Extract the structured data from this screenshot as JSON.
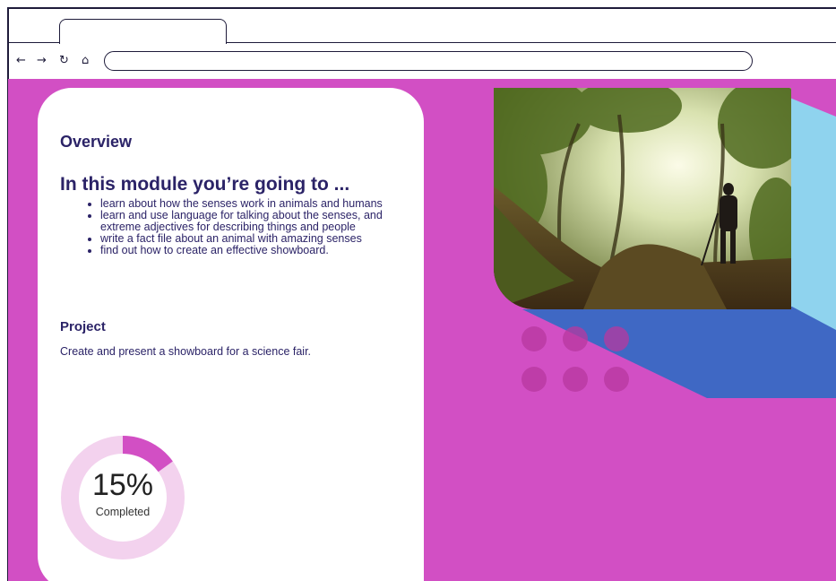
{
  "browser": {
    "nav_icons": {
      "back": "←",
      "forward": "→",
      "reload": "↻",
      "home": "⌂"
    },
    "url": ""
  },
  "card": {
    "overview_title": "Overview",
    "module_heading": "In this module you’re going to ...",
    "bullets": [
      "learn about how the senses work in animals and humans",
      "learn and use language for talking about the senses, and extreme adjectives for describing things and people",
      "write a fact file about an animal with amazing senses",
      "find out how to create an effective showboard."
    ],
    "project_title": "Project",
    "project_text": "Create and present a showboard for a science fair."
  },
  "progress": {
    "percent_text": "15%",
    "label": "Completed",
    "fraction": 0.15
  },
  "colors": {
    "page_bg": "#d24fc4",
    "heading": "#2b2367",
    "ring_track": "#f3d2ee",
    "ring_fill": "#d24fc4",
    "sky_blue": "#8fd3ee",
    "deep_blue": "#3f68c4"
  },
  "photo": {
    "icon": "hiker-forest-photo"
  }
}
